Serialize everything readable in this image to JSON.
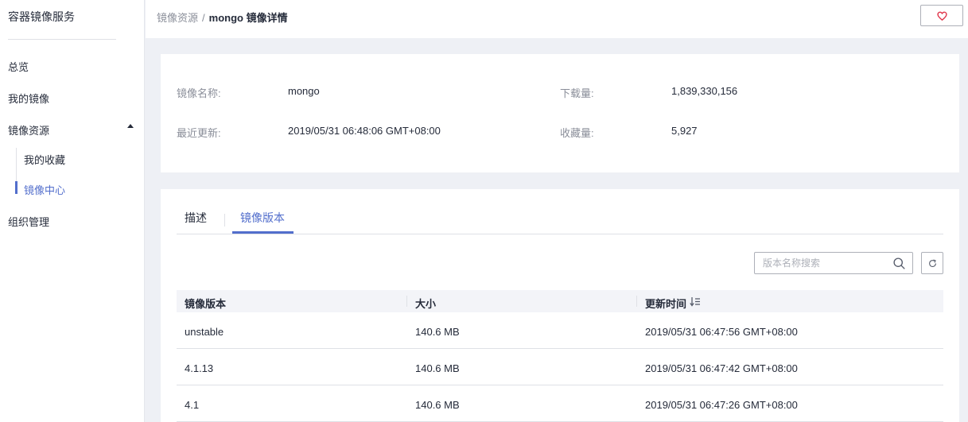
{
  "sidebar": {
    "brand": "容器镜像服务",
    "items": [
      {
        "label": "总览"
      },
      {
        "label": "我的镜像"
      },
      {
        "label": "镜像资源"
      },
      {
        "label": "我的收藏"
      },
      {
        "label": "镜像中心"
      },
      {
        "label": "组织管理"
      }
    ]
  },
  "header": {
    "breadcrumb": {
      "parent": "镜像资源",
      "separator": "/",
      "current": "mongo 镜像详情"
    }
  },
  "info": {
    "name_label": "镜像名称:",
    "name_value": "mongo",
    "downloads_label": "下载量:",
    "downloads_value": "1,839,330,156",
    "updated_label": "最近更新:",
    "updated_value": "2019/05/31 06:48:06 GMT+08:00",
    "favorites_label": "收藏量:",
    "favorites_value": "5,927"
  },
  "tabs": [
    {
      "label": "描述"
    },
    {
      "label": "镜像版本"
    }
  ],
  "search": {
    "placeholder": "版本名称搜索",
    "value": ""
  },
  "table": {
    "columns": [
      "镜像版本",
      "大小",
      "更新时间"
    ],
    "rows": [
      [
        "unstable",
        "140.6 MB",
        "2019/05/31 06:47:56 GMT+08:00"
      ],
      [
        "4.1.13",
        "140.6 MB",
        "2019/05/31 06:47:42 GMT+08:00"
      ],
      [
        "4.1",
        "140.6 MB",
        "2019/05/31 06:47:26 GMT+08:00"
      ]
    ]
  },
  "colors": {
    "accent": "#526ecc",
    "favorite": "#e0364b",
    "text": "#252b3a",
    "muted": "#8a8e99"
  }
}
